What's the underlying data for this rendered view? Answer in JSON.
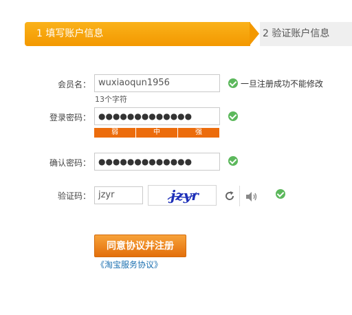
{
  "steps": {
    "step1": "1 填写账户信息",
    "step2": "2 验证账户信息"
  },
  "form": {
    "username": {
      "label": "会员名：",
      "value": "wuxiaoqun1956",
      "count_hint": "13个字符",
      "note": "一旦注册成功不能修改"
    },
    "password": {
      "label": "登录密码：",
      "value": "●●●●●●●●●●●●●",
      "strength": [
        "弱",
        "中",
        "强"
      ]
    },
    "confirm": {
      "label": "确认密码：",
      "value": "●●●●●●●●●●●●●"
    },
    "captcha": {
      "label": "验证码：",
      "value": "jzyr",
      "image_text": "jzyr"
    }
  },
  "submit_label": "同意协议并注册",
  "agreement_link": "《淘宝服务协议》",
  "colors": {
    "accent": "#f39800",
    "check": "#5cb85c",
    "strength_bar": "#ec6c0c",
    "link": "#1a6fb0"
  }
}
